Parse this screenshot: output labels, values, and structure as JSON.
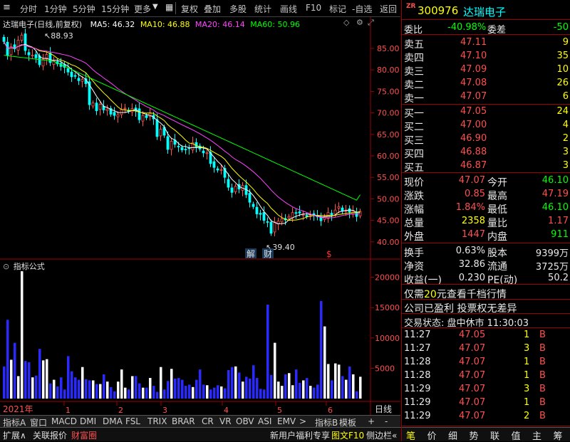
{
  "toolbar": {
    "left": [
      "分时",
      "1分钟",
      "5分钟",
      "15分钟",
      "更多"
    ],
    "right": [
      "复权",
      "叠加",
      "多股",
      "统计",
      "画线",
      "F10",
      "标记",
      "-自选",
      "返回"
    ]
  },
  "price_header": {
    "title": "达瑞电子(日线,前复权)",
    "ma5": "MA5: 46.32",
    "ma10": "MA10: 46.88",
    "ma20": "MA20: 46.14",
    "ma60": "MA60: 50.96"
  },
  "price_axis": [
    "85.00",
    "80.00",
    "75.00",
    "70.00",
    "65.00",
    "60.00",
    "55.00",
    "50.00",
    "45.00",
    "40.00"
  ],
  "annotations": {
    "high": "88.93",
    "low": "39.40",
    "jie": "解",
    "cai": "财",
    "dollar": "$"
  },
  "indicator": {
    "title": "指标公式",
    "axis": [
      "20000",
      "15000",
      "10000",
      "5000"
    ]
  },
  "time_axis": {
    "year": "2021年",
    "months": [
      "1",
      "2",
      "3",
      "4",
      "5",
      "6"
    ],
    "period": "日线"
  },
  "indicator_tabs": [
    "指标A",
    "窗口",
    "MACD",
    "DMI",
    "DMA",
    "FSL",
    "TRIX",
    "BRAR",
    "CR",
    "VR",
    "OBV",
    "ASI",
    "EMV",
    ">",
    "指标B",
    "模板",
    "+",
    "-"
  ],
  "bottom_bar": {
    "left": [
      "扩展∧",
      "关联报价",
      "财富圈"
    ],
    "right": [
      "新用户福利专享",
      "图文F10",
      "侧边栏«"
    ],
    "panel_tabs": [
      "笔",
      "价",
      "细",
      "势",
      "联",
      "值",
      "主",
      "筹"
    ]
  },
  "stock": {
    "badge": "ZR",
    "code": "300976",
    "name": "达瑞电子"
  },
  "quote": {
    "wb_label": "委比",
    "wb_value": "-40.98%",
    "wc_label": "委差",
    "wc_value": "-50",
    "asks": [
      {
        "label": "卖五",
        "price": "47.11",
        "vol": "9"
      },
      {
        "label": "卖四",
        "price": "47.10",
        "vol": "35"
      },
      {
        "label": "卖三",
        "price": "47.09",
        "vol": "10"
      },
      {
        "label": "卖二",
        "price": "47.08",
        "vol": "26"
      },
      {
        "label": "卖一",
        "price": "47.07",
        "vol": "6"
      }
    ],
    "bids": [
      {
        "label": "买一",
        "price": "47.05",
        "vol": "24"
      },
      {
        "label": "买二",
        "price": "47.00",
        "vol": "4"
      },
      {
        "label": "买三",
        "price": "46.90",
        "vol": "2"
      },
      {
        "label": "买四",
        "price": "46.88",
        "vol": "3"
      },
      {
        "label": "买五",
        "price": "46.87",
        "vol": "3"
      }
    ],
    "stats": [
      {
        "l1": "现价",
        "v1": "47.07",
        "c1": "red",
        "l2": "今开",
        "v2": "46.10",
        "c2": "grn"
      },
      {
        "l1": "涨跌",
        "v1": "0.85",
        "c1": "red",
        "l2": "最高",
        "v2": "47.19",
        "c2": "red"
      },
      {
        "l1": "涨幅",
        "v1": "1.84%",
        "c1": "red",
        "l2": "最低",
        "v2": "46.10",
        "c2": "grn"
      },
      {
        "l1": "总量",
        "v1": "2358",
        "c1": "yel",
        "l2": "量比",
        "v2": "1.17",
        "c2": "red"
      },
      {
        "l1": "外盘",
        "v1": "1447",
        "c1": "red",
        "l2": "内盘",
        "v2": "911",
        "c2": "grn"
      }
    ],
    "fin": [
      {
        "l1": "换手",
        "v1": "0.63%",
        "l2": "股本",
        "v2": "9399万"
      },
      {
        "l1": "净资",
        "v1": "32.86",
        "l2": "流通",
        "v2": "3725万"
      },
      {
        "l1": "收益(一)",
        "v1": "0.230",
        "l2": "PE(动)",
        "v2": "50.2"
      }
    ],
    "promo": [
      "仅需",
      "20",
      "元查看千档行情"
    ],
    "notice": "公司已盈利 投票权无差异",
    "status": "交易状态: 盘中休市 11:30:03"
  },
  "ticks": [
    {
      "t": "11:27",
      "p": "47.05",
      "v": "1",
      "s": "B"
    },
    {
      "t": "11:27",
      "p": "47.07",
      "v": "3",
      "s": "B"
    },
    {
      "t": "11:28",
      "p": "47.07",
      "v": "1",
      "s": "B"
    },
    {
      "t": "11:28",
      "p": "47.07",
      "v": "1",
      "s": "B"
    },
    {
      "t": "11:29",
      "p": "47.07",
      "v": "3",
      "s": "B"
    },
    {
      "t": "11:29",
      "p": "47.07",
      "v": "1",
      "s": "B"
    },
    {
      "t": "11:29",
      "p": "47.07",
      "v": "2",
      "s": "B"
    }
  ],
  "colors": {
    "up": "#ff5050",
    "down": "#00ffff",
    "ma5": "#ffffff",
    "ma10": "#ffff00",
    "ma20": "#ff44ff",
    "ma60": "#00ff00",
    "vol_up": "#ffffff",
    "vol_down": "#2a2aff",
    "frame": "#a00000"
  },
  "chart_data": {
    "type": "candlestick",
    "title": "达瑞电子(日线,前复权)",
    "ylim": [
      38,
      90
    ],
    "close": [
      86.6,
      83.4,
      85.4,
      84.9,
      86.9,
      88.1,
      84.5,
      83.5,
      83.4,
      82.8,
      81.2,
      82.5,
      83.6,
      81.7,
      82.1,
      81.4,
      80.8,
      80.6,
      79.5,
      78.4,
      78.5,
      77.5,
      77.8,
      76.8,
      71.9,
      72.3,
      70.5,
      72,
      70.7,
      70.9,
      69.7,
      69.4,
      69.6,
      70.8,
      71.1,
      70.4,
      71,
      70.5,
      68.4,
      69.4,
      68.9,
      69.9,
      68.6,
      64.5,
      66.2,
      64.8,
      61.5,
      63.4,
      62.7,
      62.1,
      61.4,
      61.4,
      61.7,
      63.1,
      62,
      61.6,
      60.7,
      60.7,
      58.2,
      57.3,
      56.7,
      56.8,
      55,
      52.7,
      51.5,
      52.9,
      52.3,
      53.1,
      51,
      49.2,
      48.2,
      46.5,
      46.4,
      45,
      44.6,
      42,
      44.6,
      44.8,
      45.3,
      45.1,
      45.9,
      46.8,
      46.7,
      46.7,
      46.3,
      45.9,
      46.1,
      46.3,
      45.8,
      44.9,
      45.9,
      46.8,
      46.3,
      47.4,
      48.2,
      47.1,
      47.4,
      46.9,
      47.1,
      45.9,
      47.1
    ],
    "volume": [
      5300,
      13000,
      6400,
      9200,
      3700,
      21000,
      6200,
      6000,
      3500,
      3800,
      8200,
      6300,
      6500,
      2500,
      3100,
      2000,
      3500,
      1500,
      7000,
      4500,
      3500,
      3100,
      5200,
      3200,
      3000,
      3000,
      2400,
      2400,
      4000,
      2800,
      1900,
      1200,
      2800,
      4800,
      1800,
      1500,
      3700,
      3700,
      2500,
      1800,
      1800,
      3400,
      2100,
      1100,
      5200,
      1500,
      2900,
      4900,
      3300,
      3400,
      3100,
      2100,
      2300,
      1900,
      3100,
      4800,
      2300,
      2200,
      1500,
      1800,
      2200,
      2000,
      1700,
      4700,
      5200,
      5300,
      4300,
      2800,
      3600,
      3300,
      5500,
      3400,
      1600,
      1500,
      15500,
      3900,
      9200,
      2800,
      2100,
      4000,
      4200,
      2200,
      4800,
      2600,
      3000,
      3400,
      2100,
      1800,
      2300,
      16100,
      11900,
      5700,
      3000,
      5800,
      5600,
      3700,
      3100,
      5300,
      4000,
      1200,
      3600
    ],
    "ma5_last": 46.32,
    "ma10_last": 46.88,
    "ma20_last": 46.14,
    "ma60_last": 50.96,
    "high": 88.93,
    "low": 39.4
  }
}
